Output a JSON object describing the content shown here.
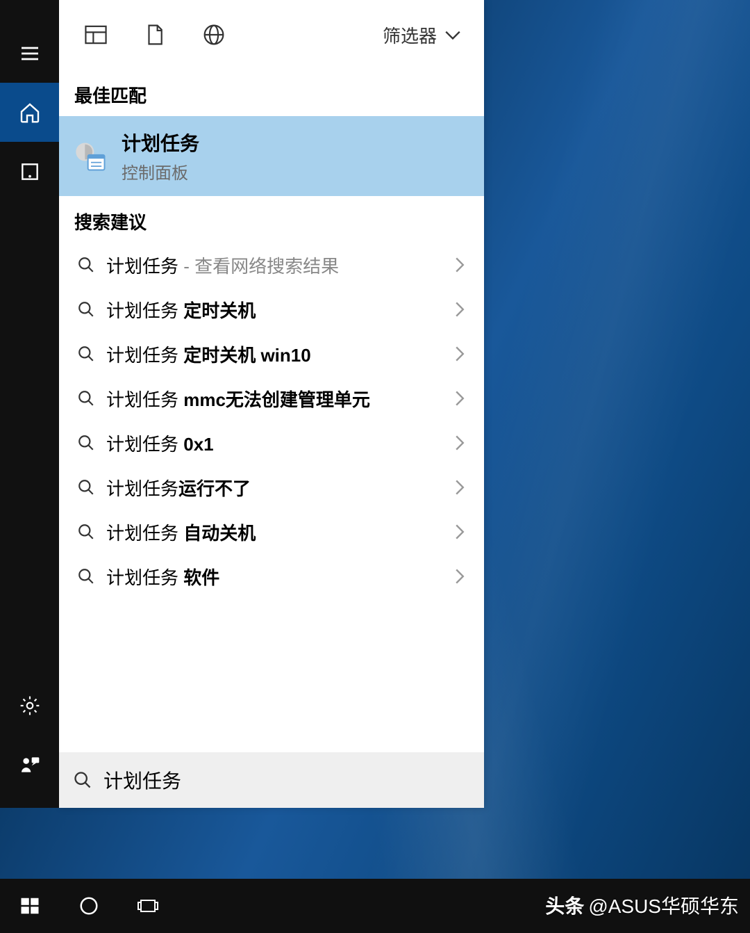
{
  "colors": {
    "accent": "#0a4b8c",
    "highlight": "#a8d1ed"
  },
  "rail": {
    "items": [
      "menu",
      "home",
      "app"
    ],
    "bottom": [
      "settings",
      "feedback"
    ]
  },
  "header": {
    "tabs": [
      "apps",
      "documents",
      "web"
    ],
    "filter_label": "筛选器"
  },
  "sections": {
    "best_match": "最佳匹配",
    "suggestions": "搜索建议"
  },
  "best_match": {
    "title": "计划任务",
    "subtitle": "控制面板"
  },
  "suggestions": [
    {
      "prefix": "计划任务",
      "bold": "",
      "meta": " - 查看网络搜索结果"
    },
    {
      "prefix": "计划任务 ",
      "bold": "定时关机",
      "meta": ""
    },
    {
      "prefix": "计划任务 ",
      "bold": "定时关机 win10",
      "meta": ""
    },
    {
      "prefix": "计划任务 ",
      "bold": "mmc无法创建管理单元",
      "meta": ""
    },
    {
      "prefix": "计划任务 ",
      "bold": "0x1",
      "meta": ""
    },
    {
      "prefix": "计划任务",
      "bold": "运行不了",
      "meta": ""
    },
    {
      "prefix": "计划任务 ",
      "bold": "自动关机",
      "meta": ""
    },
    {
      "prefix": "计划任务 ",
      "bold": "软件",
      "meta": ""
    }
  ],
  "search": {
    "value": "计划任务"
  },
  "watermark": {
    "tag": "头条",
    "handle": "@ASUS华硕华东"
  }
}
